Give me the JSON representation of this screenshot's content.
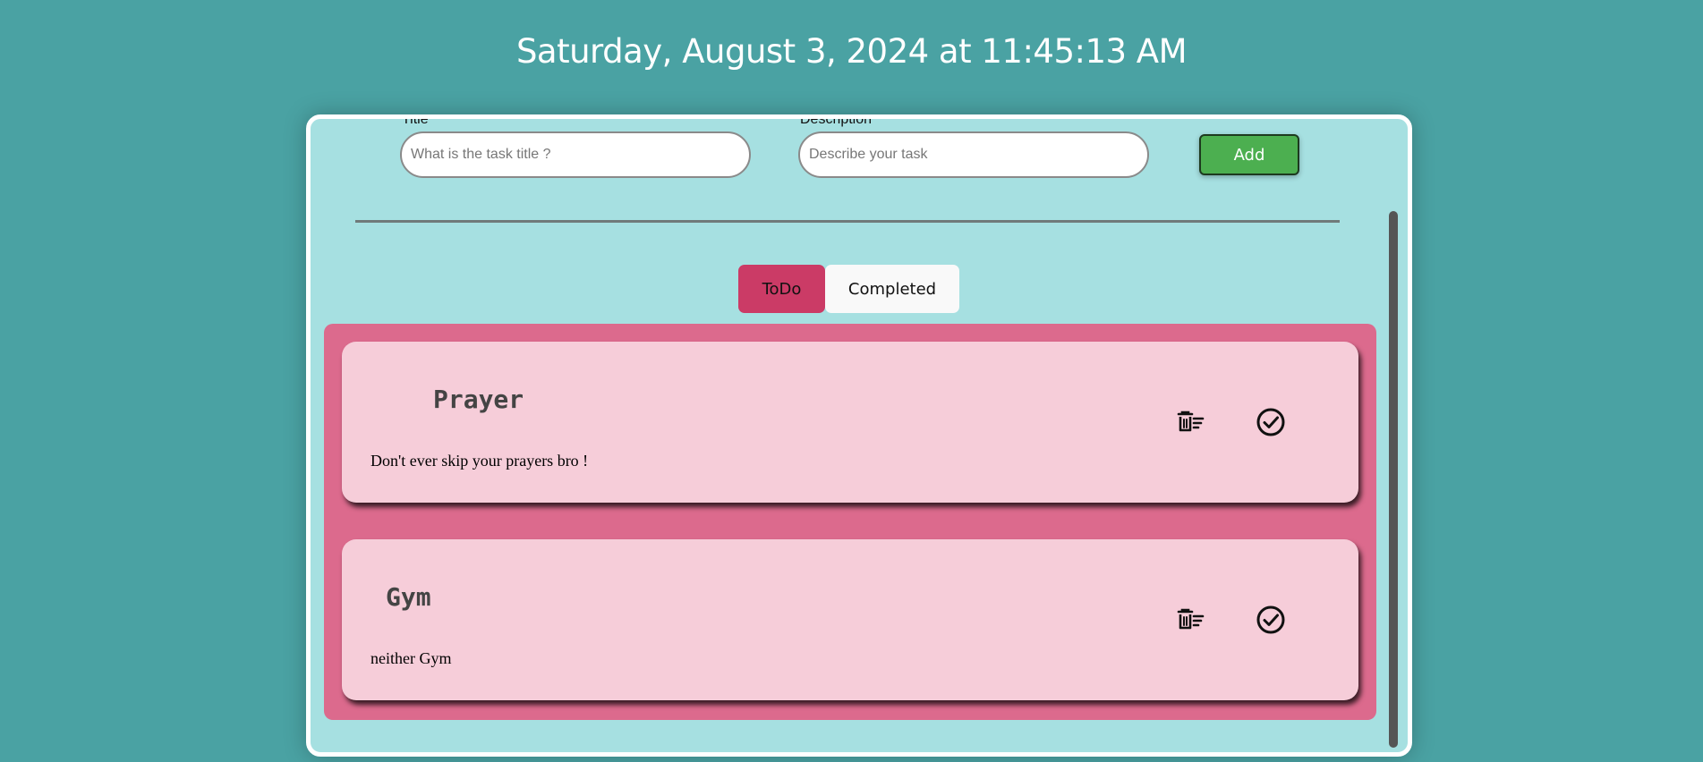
{
  "clock": {
    "text": "Saturday, August 3, 2024 at 11:45:13 AM"
  },
  "form": {
    "title_label": "Title",
    "title_placeholder": "What is the task title ?",
    "description_label": "Description",
    "description_placeholder": "Describe your task",
    "add_label": "Add"
  },
  "tabs": [
    {
      "label": "ToDo",
      "active": true
    },
    {
      "label": "Completed",
      "active": false
    }
  ],
  "tasks": [
    {
      "title": "Prayer",
      "description": "Don't ever skip your prayers bro !"
    },
    {
      "title": "Gym",
      "description": "neither Gym"
    }
  ],
  "icons": {
    "delete": "delete-list-icon",
    "complete": "check-circle-icon"
  },
  "colors": {
    "background": "#4aa2a3",
    "panel": "#a6e0e1",
    "add_button": "#4caf50",
    "active_tab": "#cb3b66",
    "list_area": "#dc6a8d",
    "task_card": "#f6cdd9"
  }
}
